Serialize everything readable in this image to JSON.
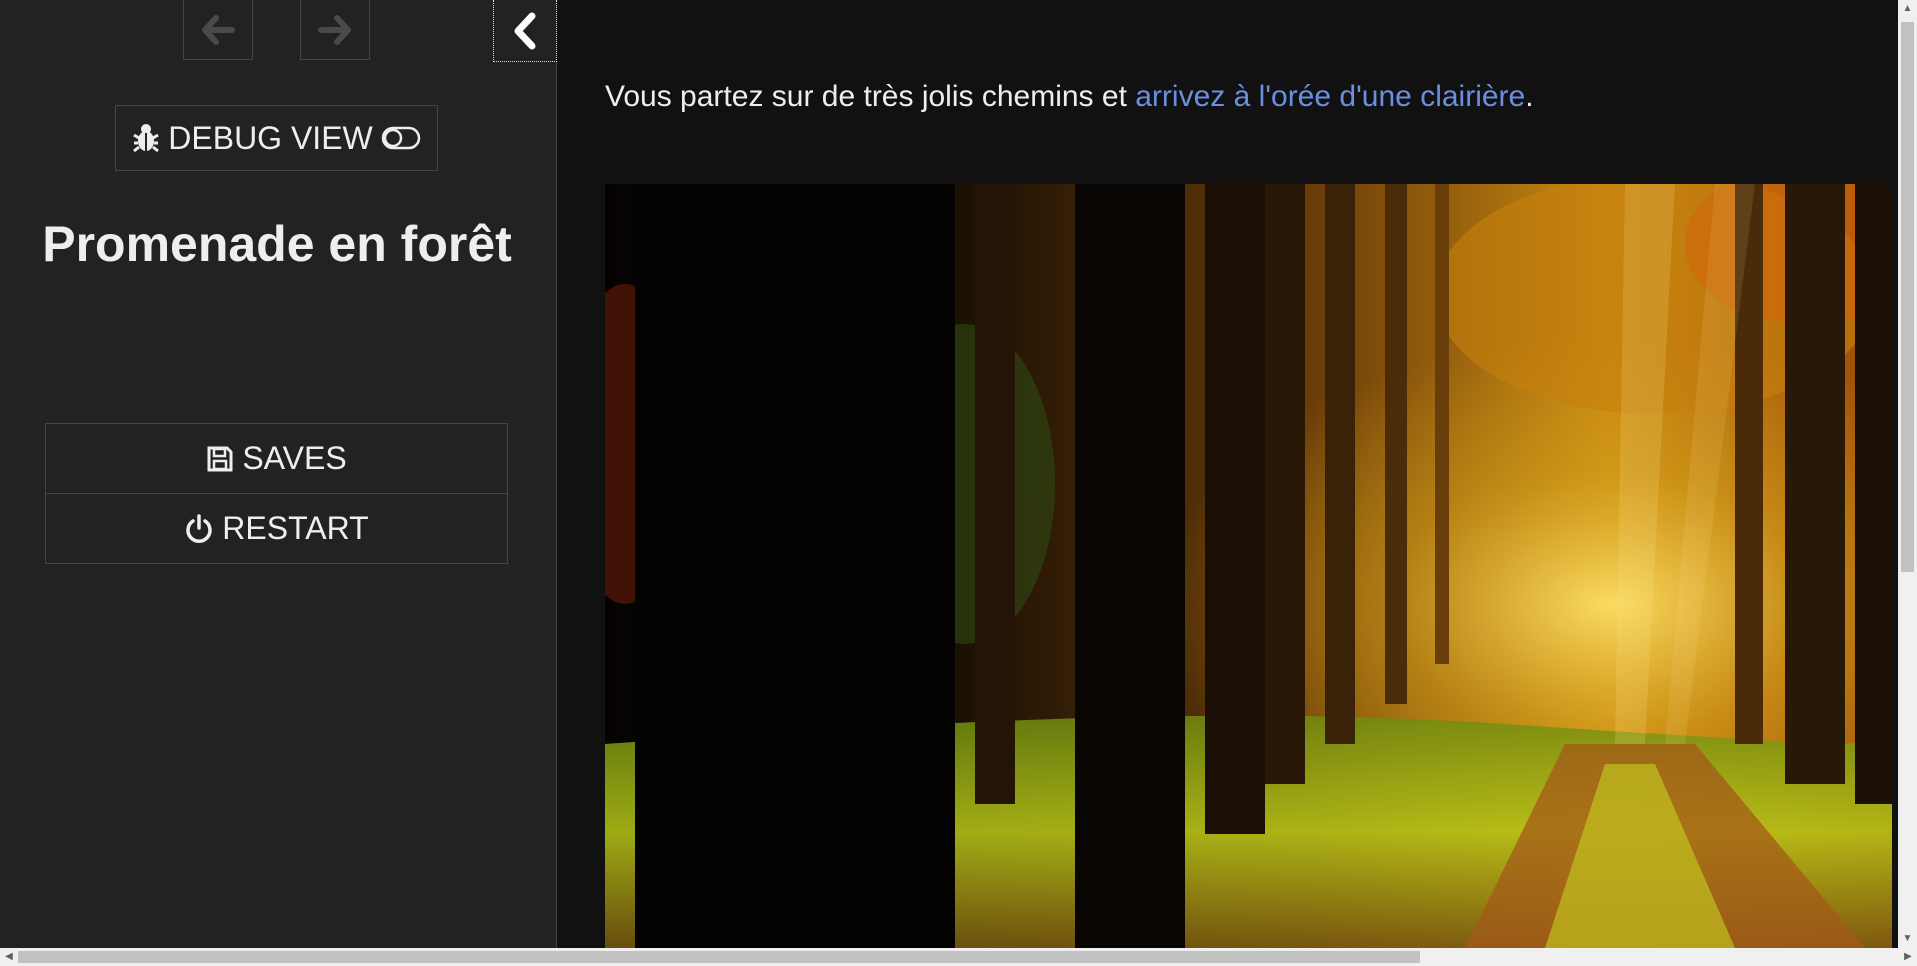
{
  "sidebar": {
    "history_back_icon": "arrow-left-icon",
    "history_forward_icon": "arrow-right-icon",
    "toggle_icon": "chevron-left-icon",
    "debug_label": "DEBUG VIEW",
    "debug_icon": "bug-icon",
    "debug_toggle_icon": "toggle-off-icon",
    "story_title": "Promenade en forêt",
    "menu": [
      {
        "label": "SAVES",
        "icon": "floppy-disk-icon"
      },
      {
        "label": "RESTART",
        "icon": "power-icon"
      }
    ]
  },
  "passage": {
    "text_before": "Vous partez sur de très jolis chemins et ",
    "link_text": "arrivez à l'orée d'une clairière",
    "text_after": ".",
    "image_subject": "forest path with sunlight through autumn trees"
  },
  "colors": {
    "sidebar_bg": "#222222",
    "passage_bg": "#111111",
    "text": "#eeeeee",
    "link": "#6b8fe0",
    "border": "#444444"
  }
}
